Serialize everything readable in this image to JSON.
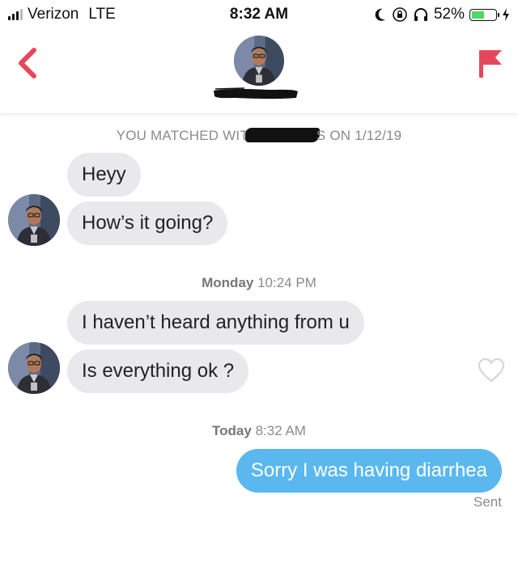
{
  "status_bar": {
    "carrier": "Verizon",
    "network": "LTE",
    "time": "8:32 AM",
    "battery": "52%",
    "battery_level": 0.52
  },
  "header": {
    "back_icon": "chevron-left-icon",
    "report_icon": "flag-icon",
    "accent_color": "#e5485c"
  },
  "conversation": {
    "match_prefix": "YOU MATCHED WIT",
    "match_suffix": "S ON 1/12/19",
    "groups": [
      {
        "messages": [
          "Heyy",
          "How’s it going?"
        ]
      },
      {
        "day": "Monday",
        "time": "10:24 PM",
        "messages": [
          "I haven’t heard anything from u",
          "Is everything ok ?"
        ]
      },
      {
        "day": "Today",
        "time": "8:32 AM",
        "outgoing": [
          "Sorry I was having diarrhea"
        ],
        "status": "Sent"
      }
    ]
  },
  "colors": {
    "incoming_bubble": "#e9e9eb",
    "outgoing_bubble": "#5ab8ef",
    "system_text": "#8a8a8a"
  }
}
